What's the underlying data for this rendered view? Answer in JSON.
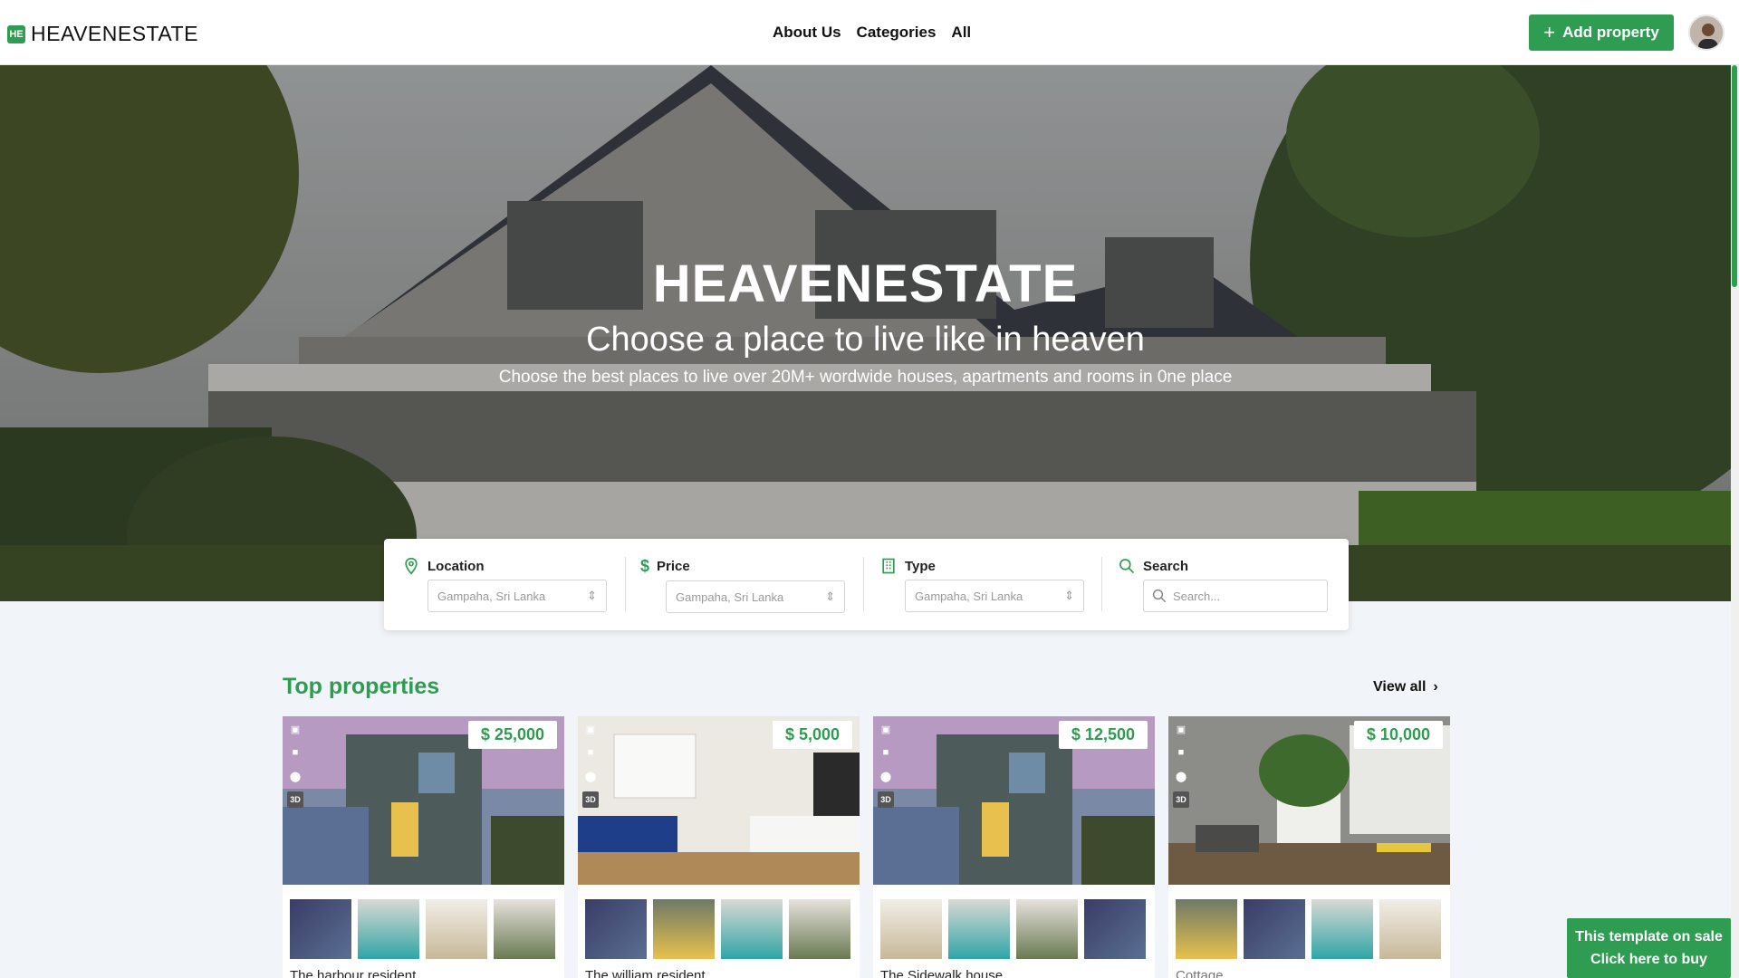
{
  "brand": {
    "badge": "HE",
    "name": "HEAVENESTATE"
  },
  "nav": {
    "links": [
      "About Us",
      "Categories",
      "All"
    ],
    "add_label": "Add property"
  },
  "hero": {
    "title": "HEAVENESTATE",
    "subtitle": "Choose a place to live like in heaven",
    "description": "Choose the best places to live over 20M+ wordwide houses, apartments and rooms in 0ne place"
  },
  "search": {
    "location": {
      "label": "Location",
      "value": "Gampaha, Sri Lanka"
    },
    "price": {
      "label": "Price",
      "value": "Gampaha, Sri Lanka"
    },
    "type": {
      "label": "Type",
      "value": "Gampaha, Sri Lanka"
    },
    "search": {
      "label": "Search",
      "placeholder": "Search..."
    }
  },
  "section": {
    "title": "Top properties",
    "view_all": "View all"
  },
  "cards": [
    {
      "price": "$ 25,000",
      "name": "The harbour resident"
    },
    {
      "price": "$ 5,000",
      "name": "The william resident"
    },
    {
      "price": "$ 12,500",
      "name": "The Sidewalk house"
    },
    {
      "price": "$ 10,000",
      "name": "Cottage"
    }
  ],
  "media_icons": [
    "image-icon",
    "video-icon",
    "location-pin-icon",
    "3d-badge"
  ],
  "badge_3d": "3D",
  "promo": {
    "line1": "This template on sale",
    "line2": "Click here to buy"
  },
  "colors": {
    "accent": "#2e9d52"
  }
}
